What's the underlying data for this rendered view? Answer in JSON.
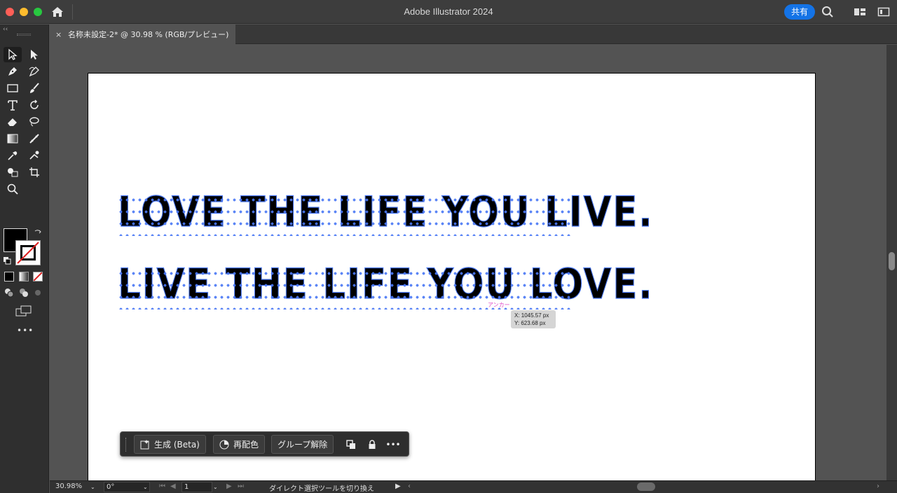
{
  "app": {
    "title": "Adobe Illustrator 2024",
    "share_label": "共有"
  },
  "document": {
    "tab_label": "名称未設定-2* @ 30.98 % (RGB/プレビュー)",
    "tab_close": "×"
  },
  "artwork": {
    "line1": "LOVE THE LIFE YOU LIVE.",
    "line2": "LIVE THE LIFE YOU LOVE.",
    "anchor_hint": "アンカー",
    "coord_x": "X: 1045.57 px",
    "coord_y": "Y: 623.68 px"
  },
  "taskbar": {
    "generate_label": "生成 (Beta)",
    "recolor_label": "再配色",
    "ungroup_label": "グループ解除",
    "more_label": "•••"
  },
  "statusbar": {
    "zoom": "30.98%",
    "rotation": "0°",
    "artboard_number": "1",
    "status_text": "ダイレクト選択ツールを切り換え"
  },
  "toolbar": {
    "more_label": "•••",
    "collapse_label": "‹‹"
  },
  "colors": {
    "accent": "#1473e6",
    "selection": "#4a78f5",
    "fill": "#000000",
    "stroke": "#ffffff"
  },
  "icons": [
    "home-icon",
    "search-icon",
    "workspace-icon",
    "panel-icon",
    "selection-tool-icon",
    "direct-selection-tool-icon",
    "pen-tool-icon",
    "curvature-tool-icon",
    "rectangle-tool-icon",
    "paintbrush-tool-icon",
    "type-tool-icon",
    "rotate-tool-icon",
    "eraser-tool-icon",
    "lasso-tool-icon",
    "gradient-tool-icon",
    "puppet-warp-icon",
    "eyedropper-tool-icon",
    "blend-tool-icon",
    "shape-builder-icon",
    "artboard-tool-icon",
    "zoom-tool-icon"
  ]
}
